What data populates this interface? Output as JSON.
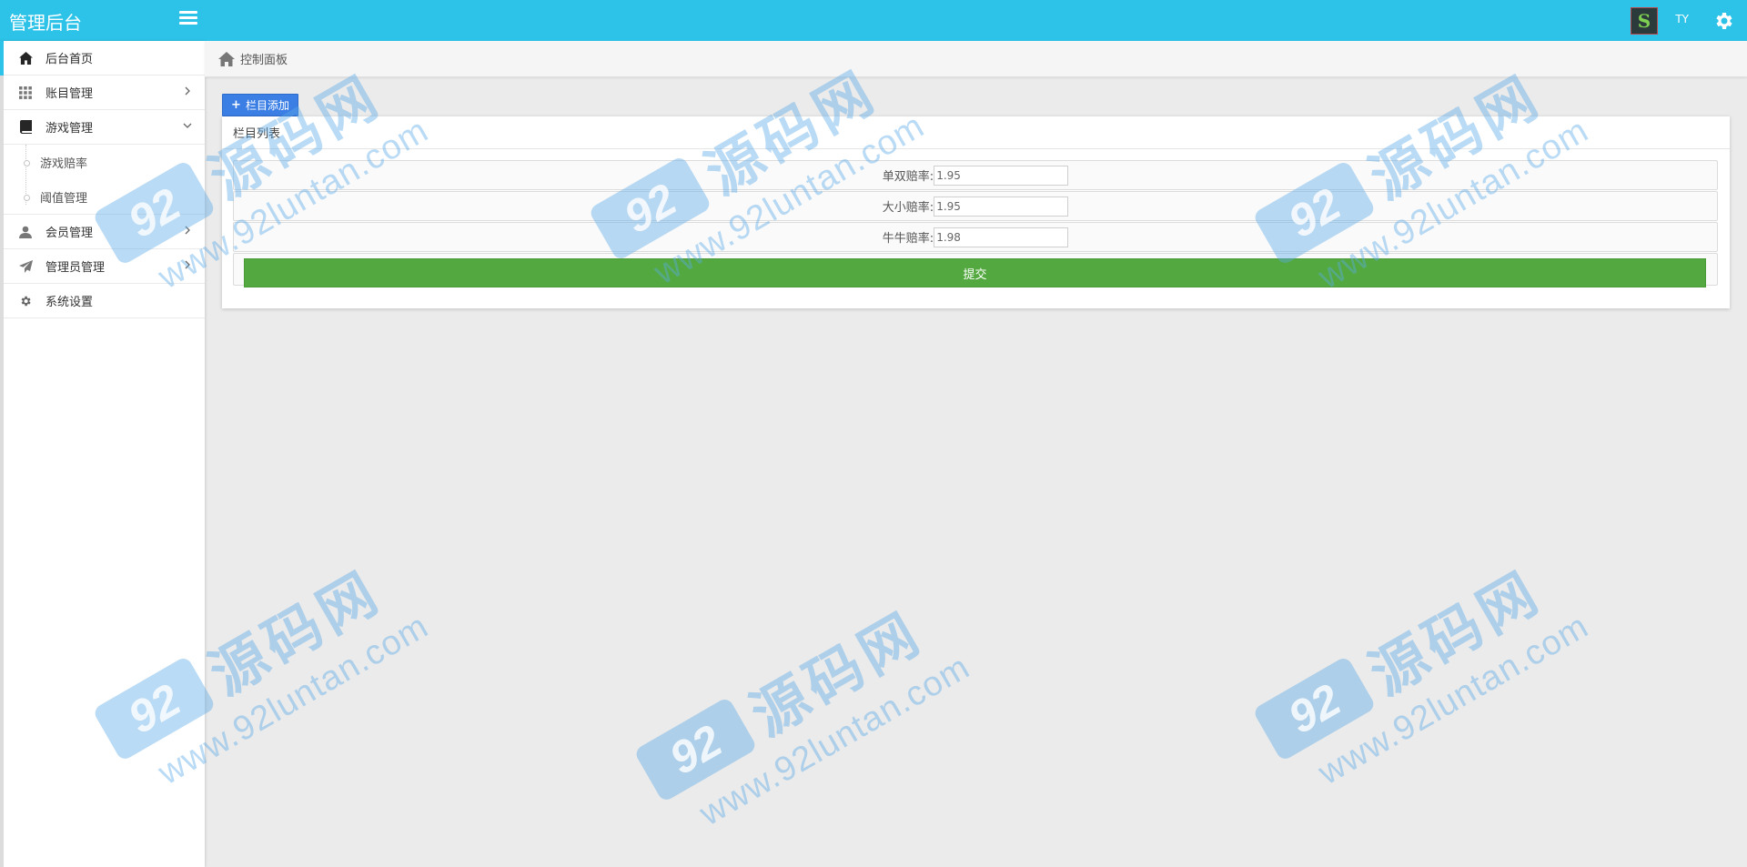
{
  "header": {
    "brand": "管理后台",
    "avatar_letter": "S",
    "username": "TY",
    "accent": "#2dc3e8"
  },
  "sidebar": {
    "items": [
      {
        "label": "后台首页",
        "icon": "home-icon"
      },
      {
        "label": "账目管理",
        "icon": "grid-icon"
      },
      {
        "label": "游戏管理",
        "icon": "book-icon"
      },
      {
        "label": "会员管理",
        "icon": "user-icon"
      },
      {
        "label": "管理员管理",
        "icon": "send-icon"
      },
      {
        "label": "系统设置",
        "icon": "gear-icon"
      }
    ],
    "submenu": [
      {
        "label": "游戏赔率"
      },
      {
        "label": "阈值管理"
      }
    ]
  },
  "breadcrumb": {
    "label": "控制面板"
  },
  "main": {
    "add_button": "栏目添加",
    "panel_title": "栏目列表",
    "fields": [
      {
        "label": "单双赔率:",
        "value": "1.95"
      },
      {
        "label": "大小赔率:",
        "value": "1.95"
      },
      {
        "label": "牛牛赔率:",
        "value": "1.98"
      }
    ],
    "submit": "提交",
    "submit_color": "#53a93f"
  },
  "watermark": {
    "logo": "92",
    "cn": "源码网",
    "url": "www.92luntan.com"
  }
}
